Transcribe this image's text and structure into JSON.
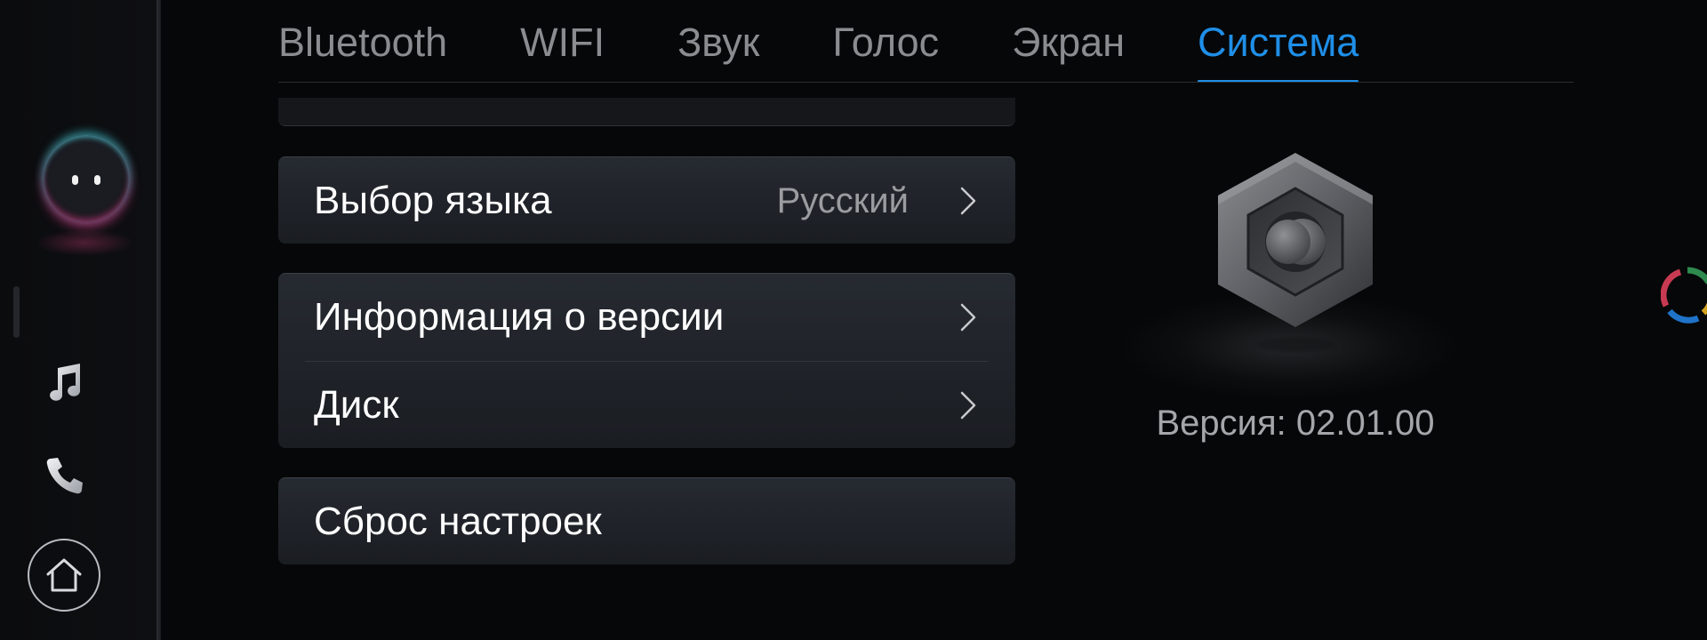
{
  "tabs": [
    {
      "label": "Bluetooth",
      "active": false
    },
    {
      "label": "WIFI",
      "active": false
    },
    {
      "label": "Звук",
      "active": false
    },
    {
      "label": "Голос",
      "active": false
    },
    {
      "label": "Экран",
      "active": false
    },
    {
      "label": "Система",
      "active": true
    }
  ],
  "settings": {
    "language": {
      "label": "Выбор языка",
      "value": "Русский"
    },
    "version_info": {
      "label": "Информация о версии"
    },
    "disk": {
      "label": "Диск"
    },
    "reset": {
      "label": "Сброс настроек"
    }
  },
  "info_panel": {
    "version_text": "Версия: 02.01.00"
  },
  "dock": {
    "icons": [
      "assistant-icon",
      "music-note-icon",
      "phone-icon",
      "home-icon"
    ]
  },
  "colors": {
    "accent": "#1f8fe8",
    "tab_inactive": "#8a8c90",
    "background": "#060708"
  }
}
